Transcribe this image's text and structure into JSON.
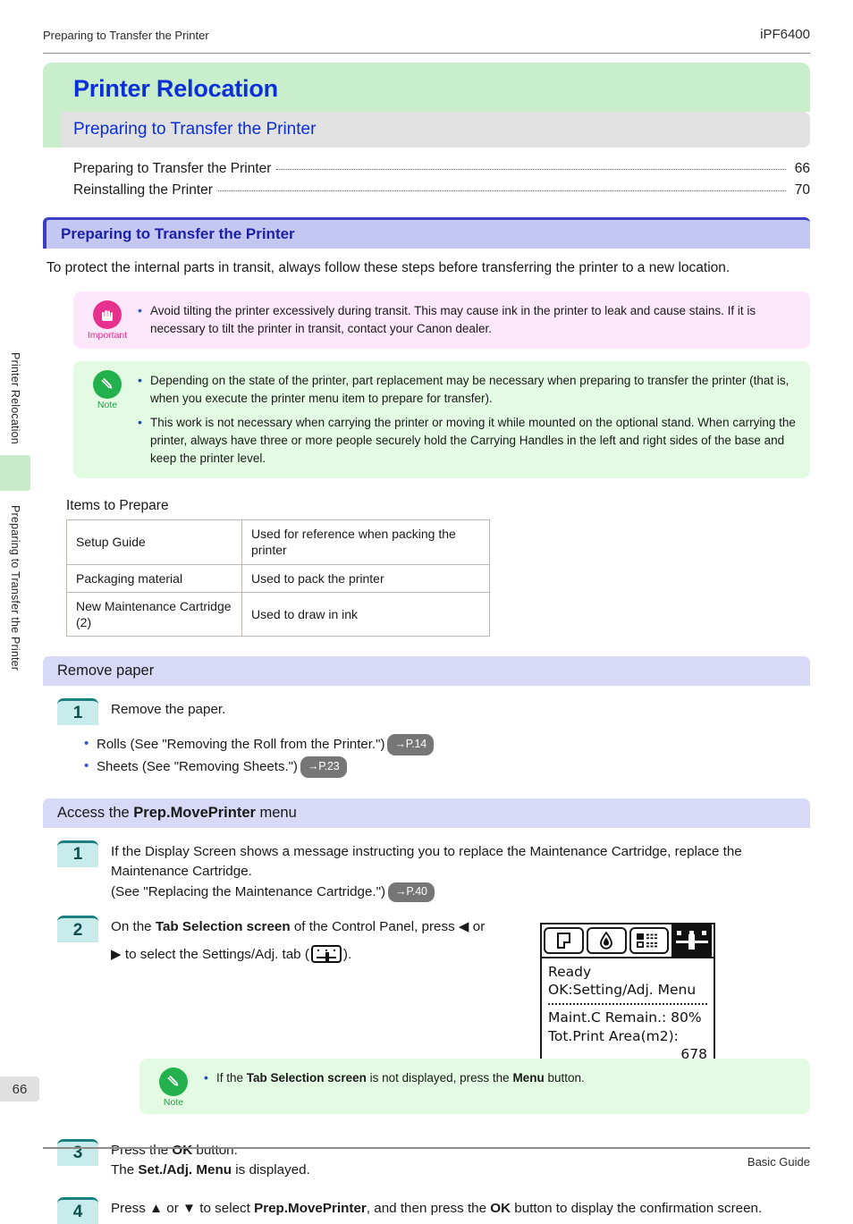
{
  "header": {
    "left_title": "Preparing to Transfer the Printer",
    "model": "iPF6400"
  },
  "sidebar": {
    "tab_top": "Printer Relocation",
    "tab_bottom": "Preparing to Transfer the Printer",
    "page_number": "66"
  },
  "chapter": {
    "title": "Printer Relocation",
    "section": "Preparing to Transfer the Printer"
  },
  "toc": [
    {
      "label": "Preparing to Transfer the Printer",
      "page": "66"
    },
    {
      "label": "Reinstalling the Printer",
      "page": "70"
    }
  ],
  "main": {
    "heading": "Preparing to Transfer the Printer",
    "intro": "To protect the internal parts in transit, always follow these steps before transferring the printer to a new location."
  },
  "important": {
    "caption": "Important",
    "items": [
      "Avoid tilting the printer excessively during transit. This may cause ink in the printer to leak and cause stains. If it is necessary to tilt the printer in transit, contact your Canon dealer."
    ]
  },
  "note_main": {
    "caption": "Note",
    "items": [
      "Depending on the state of the printer, part replacement may be necessary when preparing to transfer the printer (that is, when you execute the printer menu item to prepare for transfer).",
      "This work is not necessary when carrying the printer or moving it while mounted on the optional stand. When carrying the printer, always have three or more people securely hold the Carrying Handles in the left and right sides of the base and keep the printer level."
    ]
  },
  "items_to_prepare": {
    "label": "Items to Prepare",
    "rows": [
      {
        "item": "Setup Guide",
        "use": "Used for reference when packing the printer"
      },
      {
        "item": "Packaging material",
        "use": "Used to pack the printer"
      },
      {
        "item": "New Maintenance Cartridge (2)",
        "use": "Used to draw in ink"
      }
    ]
  },
  "remove_paper": {
    "bar_title": "Remove paper",
    "step1_number": "1",
    "step1_text": "Remove the paper.",
    "bullets": [
      {
        "text": "Rolls  (See \"Removing the Roll from the Printer.\")",
        "ref": "→P.14"
      },
      {
        "text": "Sheets  (See \"Removing Sheets.\")",
        "ref": "→P.23"
      }
    ]
  },
  "access_menu": {
    "bar_prefix": "Access the ",
    "bar_bold": "Prep.MovePrinter",
    "bar_suffix": " menu",
    "step1_number": "1",
    "step1_line1": "If the Display Screen shows a message instructing you to replace the Maintenance Cartridge, replace the Maintenance Cartridge.",
    "step1_line2": "(See \"Replacing the Maintenance Cartridge.\")",
    "step1_ref": "→P.40",
    "step2_number": "2",
    "step2_part1": "On the ",
    "step2_bold1": "Tab Selection screen",
    "step2_part2": " of the Control Panel, press ",
    "step2_arrow_left": "◀",
    "step2_part3": " or",
    "step2_arrow_right": "▶",
    "step2_part4": " to select the Settings/Adj. tab (",
    "step2_part5": ").",
    "step3_number": "3",
    "step3_part1": "Press the ",
    "step3_bold1": "OK",
    "step3_part2": " button.",
    "step3_part3": "The ",
    "step3_bold2": "Set./Adj. Menu",
    "step3_part4": " is displayed.",
    "step4_number": "4",
    "step4_part1": "Press ▲ or ▼ to select ",
    "step4_bold1": "Prep.MovePrinter",
    "step4_part2": ", and then press the ",
    "step4_bold2": "OK",
    "step4_part3": " button to display the confirmation screen."
  },
  "note_tab": {
    "caption": "Note",
    "part1": "If the ",
    "bold1": "Tab Selection screen",
    "part2": " is not displayed, press the ",
    "bold2": "Menu",
    "part3": " button."
  },
  "lcd": {
    "tabs": [
      {
        "name": "paper-tab",
        "active": false
      },
      {
        "name": "ink-tab",
        "active": false
      },
      {
        "name": "job-tab",
        "active": false
      },
      {
        "name": "settings-adj-tab",
        "active": true
      }
    ],
    "line1": "Ready",
    "line2": "OK:Setting/Adj. Menu",
    "line3": "Maint.C Remain.: 80%",
    "line4": "Tot.Print Area(m2):",
    "line5": "678"
  },
  "footer": {
    "text": "Basic Guide"
  },
  "colors": {
    "chapter_green": "#c9eecb",
    "title_blue": "#0b2fd8",
    "heading_bar": "#c3c7f2",
    "subbar_purple": "#d8d8f7",
    "important_pink": "#fce8fa",
    "note_green": "#e2fbe2",
    "step_badge": "#c8ecec",
    "ref_pill": "#767676"
  }
}
